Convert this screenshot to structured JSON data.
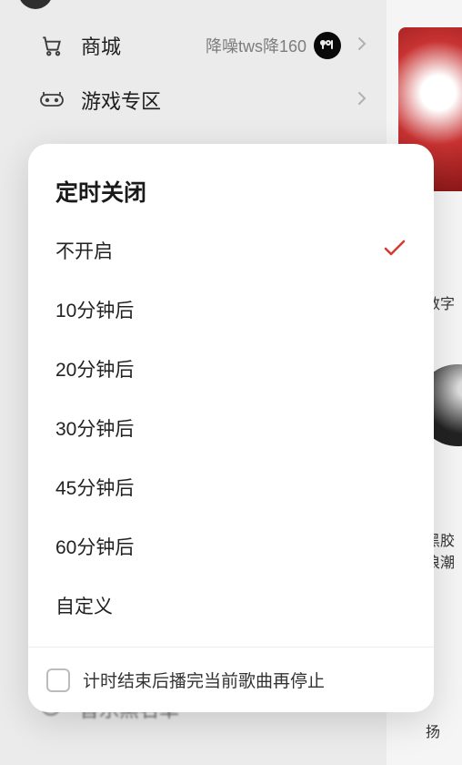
{
  "menu": {
    "mall": {
      "label": "商城",
      "sub": "降噪tws降160"
    },
    "games": {
      "label": "游戏专区"
    },
    "blacklist": {
      "label": "音乐黑名单"
    }
  },
  "side": {
    "lbl1": "数字",
    "lbl2": "黑胶\n浪潮",
    "lbl3": "扬"
  },
  "modal": {
    "title": "定时关闭",
    "options": [
      "不开启",
      "10分钟后",
      "20分钟后",
      "30分钟后",
      "45分钟后",
      "60分钟后",
      "自定义"
    ],
    "selected_index": 0,
    "footer": "计时结束后播完当前歌曲再停止"
  }
}
